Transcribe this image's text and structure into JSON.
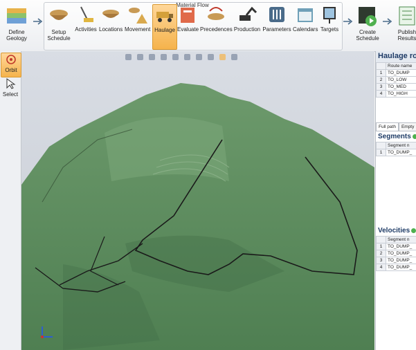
{
  "ribbon": {
    "group_title": "Material Flow",
    "define_geology": "Define Geology",
    "setup_schedule": "Setup Schedule",
    "activities": "Activities",
    "locations": "Locations",
    "movement": "Movement",
    "haulage": "Haulage",
    "evaluate": "Evaluate",
    "precedences": "Precedences",
    "production": "Production",
    "parameters": "Parameters",
    "calendars": "Calendars",
    "targets": "Targets",
    "create_schedule": "Create Schedule",
    "publish_results": "Publish Results"
  },
  "tools": {
    "orbit": "Orbit",
    "select": "Select"
  },
  "haulage_routes": {
    "title": "Haulage route",
    "column": "Route name",
    "rows": [
      {
        "index": "1",
        "name": "TO_DUMP"
      },
      {
        "index": "2",
        "name": "TO_LOW"
      },
      {
        "index": "3",
        "name": "TO_MED"
      },
      {
        "index": "4",
        "name": "TO_HIGH"
      }
    ]
  },
  "tabs": {
    "full_path": "Full path",
    "empty": "Empty"
  },
  "segments": {
    "title": "Segments",
    "column": "Segment n",
    "rows": [
      {
        "index": "1",
        "name": "TO_DUMP_"
      }
    ]
  },
  "velocities": {
    "title": "Velocities",
    "column": "Segment n",
    "rows": [
      {
        "index": "1",
        "name": "TO_DUMP_"
      },
      {
        "index": "2",
        "name": "TO_DUMP_"
      },
      {
        "index": "3",
        "name": "TO_DUMP_"
      },
      {
        "index": "4",
        "name": "TO_DUMP_"
      }
    ]
  },
  "colors": {
    "terrain": "#5a8a5c",
    "terrain_dark": "#3f6b44",
    "accent": "#f5b34c",
    "route_line": "#1a1a1a"
  }
}
